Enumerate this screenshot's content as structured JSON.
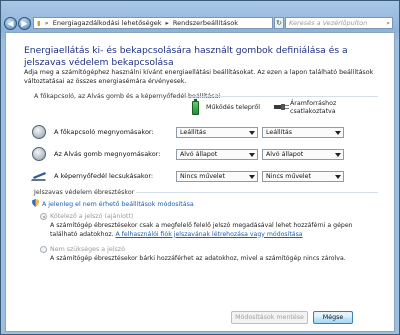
{
  "address": {
    "crumbs": [
      "Energiagazdálkodási lehetőségek",
      "Rendszerbeállítások"
    ],
    "search_placeholder": "Keresés a Vezérlőpulton"
  },
  "page": {
    "heading": "Energiaellátás ki- és bekapcsolására használt gombok definiálása és a jelszavas védelem bekapcsolása",
    "intro": "Adja meg a számítógéphez használni kívánt energiaellátási beállításokat. Az ezen a lapon található beállítások változtatásai az összes energiasémára érvényesek."
  },
  "buttons_section": {
    "title": "A főkapcsoló, az Alvás gomb és a képernyőfedél beállításai",
    "col_battery": "Működés telepről",
    "col_plugged": "Áramforráshoz csatlakoztatva",
    "rows": [
      {
        "label": "A főkapcsoló megnyomásakor:",
        "battery": "Leállítás",
        "plugged": "Leállítás"
      },
      {
        "label": "Az Alvás gomb megnyomásakor:",
        "battery": "Alvó állapot",
        "plugged": "Alvó állapot"
      },
      {
        "label": "A képernyőfedél lecsukásakor:",
        "battery": "Nincs művelet",
        "plugged": "Nincs művelet"
      }
    ]
  },
  "password_section": {
    "title": "Jelszavas védelem ébresztéskor",
    "change_link": "A jelenleg el nem érhető beállítások módosítása",
    "option_required": {
      "label": "Kötelező a jelszó (ajánlott)",
      "desc": "A számítógép ébresztésekor csak a megfelelő felelő jelszó megadásával lehet hozzáférni a gépen található adatokhoz.",
      "link": "A felhasználói fiók jelszavának létrehozása vagy módosítása"
    },
    "option_not_required": {
      "label": "Nem szükséges a jelszó",
      "desc": "A számítógép ébresztésekor bárki hozzáférhet az adatokhoz, mivel a számítógép nincs zárolva."
    }
  },
  "footer": {
    "save_label": "Módosítások mentése",
    "cancel_label": "Mégse"
  }
}
